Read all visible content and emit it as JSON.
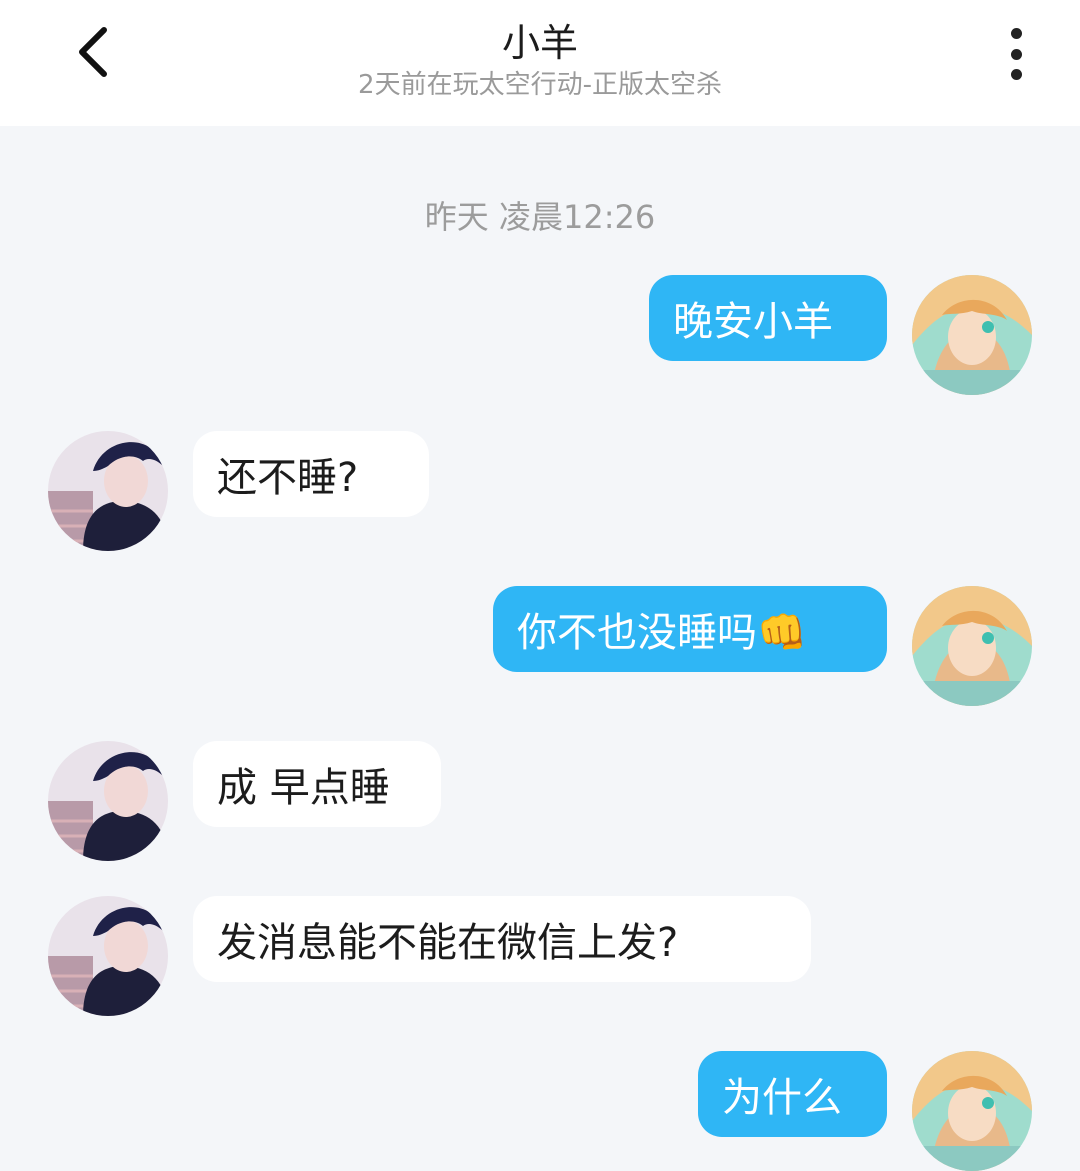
{
  "header": {
    "title": "小羊",
    "subtitle": "2天前在玩太空行动-正版太空杀"
  },
  "chat": {
    "timestamp": "昨天 凌晨12:26",
    "messages": [
      {
        "side": "out",
        "text": "晚安小羊"
      },
      {
        "side": "in",
        "text": "还不睡?"
      },
      {
        "side": "out",
        "text": "你不也没睡吗👊"
      },
      {
        "side": "in",
        "text": "成 早点睡"
      },
      {
        "side": "in",
        "text": "发消息能不能在微信上发?"
      },
      {
        "side": "out",
        "text": "为什么"
      }
    ]
  },
  "colors": {
    "background": "#f4f6f9",
    "outgoing_bubble": "#2fb6f5",
    "incoming_bubble": "#ffffff"
  }
}
